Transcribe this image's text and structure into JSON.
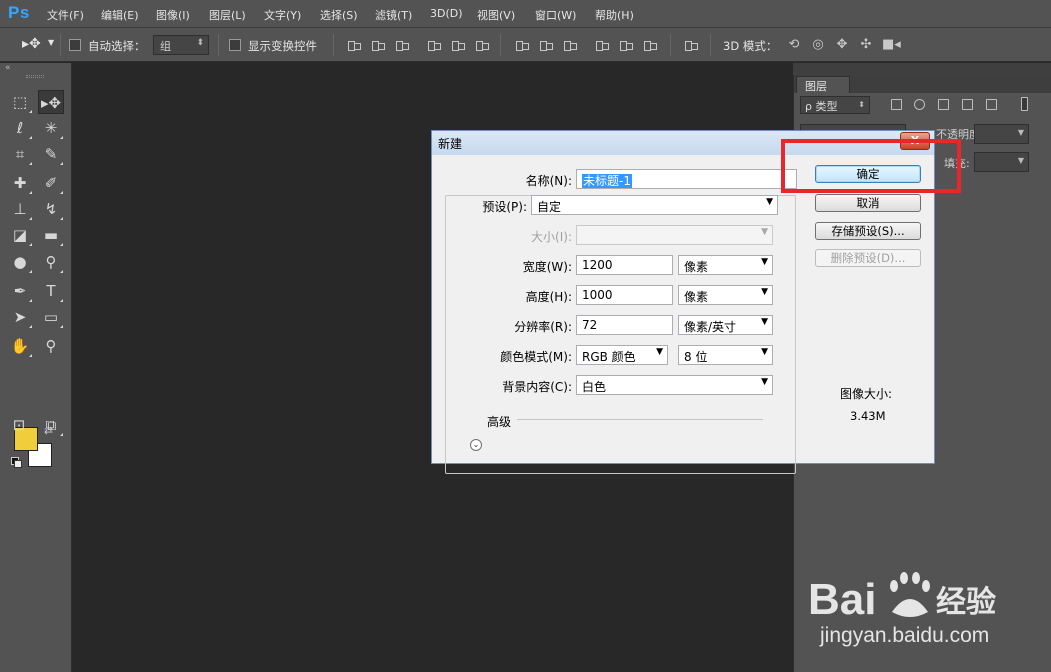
{
  "app": {
    "logo": "Ps"
  },
  "menu": [
    {
      "id": "file",
      "label": "文件(F)"
    },
    {
      "id": "edit",
      "label": "编辑(E)"
    },
    {
      "id": "image",
      "label": "图像(I)"
    },
    {
      "id": "layer",
      "label": "图层(L)"
    },
    {
      "id": "type",
      "label": "文字(Y)"
    },
    {
      "id": "select",
      "label": "选择(S)"
    },
    {
      "id": "filter",
      "label": "滤镜(T)"
    },
    {
      "id": "3d",
      "label": "3D(D)"
    },
    {
      "id": "view",
      "label": "视图(V)"
    },
    {
      "id": "window",
      "label": "窗口(W)"
    },
    {
      "id": "help",
      "label": "帮助(H)"
    }
  ],
  "options_bar": {
    "auto_select_label": "自动选择：",
    "auto_select_value": "组",
    "show_transform_label": "显示变换控件",
    "mode_3d_label": "3D 模式："
  },
  "layers_panel": {
    "tab_label": "图层",
    "filter_label": "ρ 类型",
    "opacity_label": "不透明度:",
    "fill_label": "填充:"
  },
  "dialog": {
    "title": "新建",
    "close_label": "X",
    "name_label": "名称(N):",
    "name_value": "未标题-1",
    "preset_label": "预设(P):",
    "preset_value": "自定",
    "size_label": "大小(I):",
    "size_value": "",
    "width_label": "宽度(W):",
    "width_value": "1200",
    "width_unit": "像素",
    "height_label": "高度(H):",
    "height_value": "1000",
    "height_unit": "像素",
    "resolution_label": "分辨率(R):",
    "resolution_value": "72",
    "resolution_unit": "像素/英寸",
    "color_mode_label": "颜色模式(M):",
    "color_mode_value": "RGB 颜色",
    "bit_depth_value": "8 位",
    "background_label": "背景内容(C):",
    "background_value": "白色",
    "advanced_label": "高级",
    "ok_label": "确定",
    "cancel_label": "取消",
    "save_preset_label": "存储预设(S)...",
    "delete_preset_label": "删除预设(D)...",
    "image_size_label": "图像大小:",
    "image_size_value": "3.43M"
  },
  "colors": {
    "foreground": "#f0cd3b",
    "background": "#ffffff",
    "highlight": "#e8262b"
  },
  "watermark": {
    "logo_text": "Baidu经验",
    "url": "jingyan.baidu.com"
  }
}
